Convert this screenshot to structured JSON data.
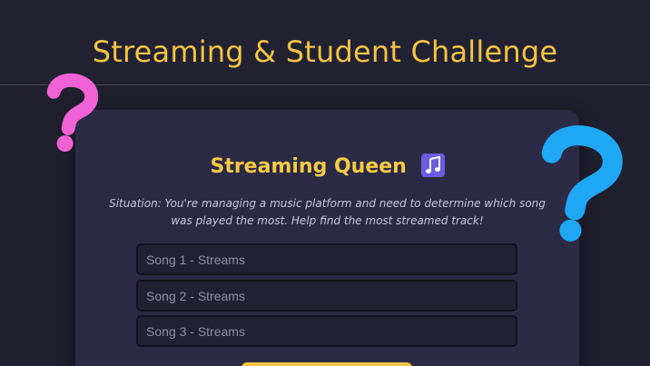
{
  "header": {
    "title": "Streaming & Student Challenge"
  },
  "card": {
    "title": "Streaming Queen",
    "title_icon": "musical-notes-icon",
    "description": "Situation: You're managing a music platform and need to determine which song was played the most. Help find the most streamed track!",
    "fields": [
      {
        "placeholder": "Song 1 - Streams",
        "value": ""
      },
      {
        "placeholder": "Song 2 - Streams",
        "value": ""
      },
      {
        "placeholder": "Song 3 - Streams",
        "value": ""
      }
    ]
  },
  "decorations": [
    {
      "icon": "question-mark-icon",
      "color": "#f062d6"
    },
    {
      "icon": "question-mark-icon",
      "color": "#1ea8f5"
    }
  ],
  "colors": {
    "background": "#1f1f2e",
    "header": "#222233",
    "card": "#2c2b45",
    "accent": "#f3c443",
    "pink": "#f062d6",
    "blue": "#1ea8f5"
  }
}
